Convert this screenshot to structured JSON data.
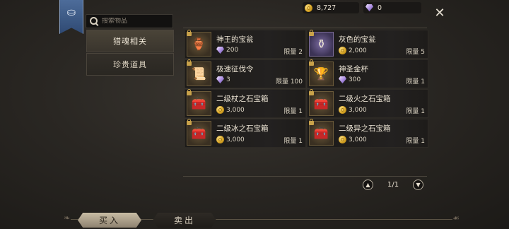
{
  "search": {
    "placeholder": "搜索物品"
  },
  "categories": [
    {
      "label": "猎魂相关",
      "active": true
    },
    {
      "label": "珍贵道具",
      "active": false
    }
  ],
  "currency": {
    "gold": "8,727",
    "gems": "0"
  },
  "items": [
    {
      "name": "神王的宝瓮",
      "cost_type": "gem",
      "price": "200",
      "limit": "限量 2",
      "glyph": "🏺"
    },
    {
      "name": "灰色的宝瓮",
      "cost_type": "coin",
      "price": "2,000",
      "limit": "限量 5",
      "glyph": "⚱"
    },
    {
      "name": "极速征伐令",
      "cost_type": "gem",
      "price": "3",
      "limit": "限量 100",
      "glyph": "📜"
    },
    {
      "name": "神圣金杯",
      "cost_type": "gem",
      "price": "300",
      "limit": "限量 1",
      "glyph": "🏆"
    },
    {
      "name": "二级杖之石宝箱",
      "cost_type": "coin",
      "price": "3,000",
      "limit": "限量 1",
      "glyph": "🧰"
    },
    {
      "name": "二级火之石宝箱",
      "cost_type": "coin",
      "price": "3,000",
      "limit": "限量 1",
      "glyph": "🧰"
    },
    {
      "name": "二级冰之石宝箱",
      "cost_type": "coin",
      "price": "3,000",
      "limit": "限量 1",
      "glyph": "🧰"
    },
    {
      "name": "二级异之石宝箱",
      "cost_type": "coin",
      "price": "3,000",
      "limit": "限量 1",
      "glyph": "🧰"
    }
  ],
  "pagination": {
    "text": "1/1"
  },
  "tabs": {
    "buy": "买入",
    "sell": "卖出"
  },
  "colors": {
    "accent_gold": "#d4a020",
    "gem_purple": "#b79ae8",
    "banner_blue": "#3d5a85"
  }
}
